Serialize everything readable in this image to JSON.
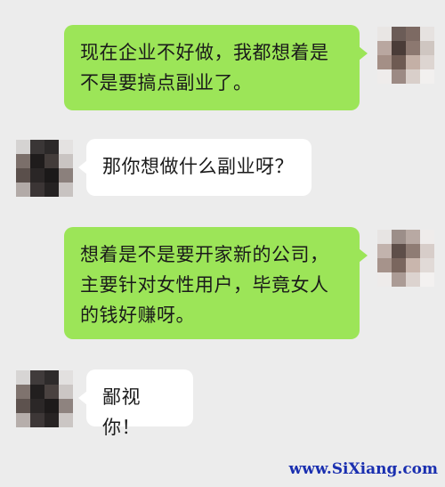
{
  "chat": {
    "messages": [
      {
        "side": "right",
        "text": "现在企业不好做，我都想着是不是要搞点副业了。"
      },
      {
        "side": "left",
        "text": "那你想做什么副业呀？"
      },
      {
        "side": "right",
        "text": "想着是不是要开家新的公司，主要针对女性用户，毕竟女人的钱好赚呀。"
      },
      {
        "side": "left",
        "text": "鄙视你！"
      }
    ]
  },
  "watermark": "www.SiXiang.com",
  "colors": {
    "background": "#ececec",
    "bubble_right": "#9ce558",
    "bubble_left": "#ffffff",
    "watermark": "#1a2fb0"
  },
  "avatars": {
    "user_right": "pixelated-avatar",
    "user_left": "pixelated-avatar"
  }
}
